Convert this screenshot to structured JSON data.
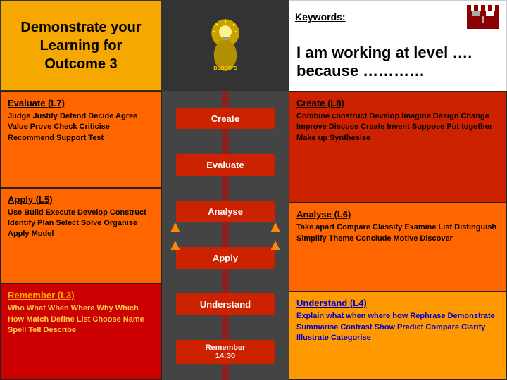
{
  "header": {
    "demonstrate_title": "Demonstrate your Learning for Outcome 3",
    "keywords_label": "Keywords:",
    "i_am_working": "I am working at level …. because …………"
  },
  "left_column": {
    "l7": {
      "title": "Evaluate (L7)",
      "content": "Judge Justify Defend Decide Agree Value Prove Check Criticise Recommend Support Test"
    },
    "l5": {
      "title": "Apply (L5)",
      "content": "Use Build Execute Develop Construct Identify Plan Select Solve Organise Apply Model"
    },
    "l3": {
      "title": "Remember (L3)",
      "content": "Who What When Where Why Which How Match Define List Choose Name Spell Tell Describe"
    }
  },
  "center_column": {
    "steps": [
      {
        "label": "Create"
      },
      {
        "label": "Evaluate"
      },
      {
        "label": "Analyse"
      },
      {
        "label": "Apply"
      },
      {
        "label": "Understand"
      },
      {
        "label": "Remember"
      }
    ],
    "time": "14:30"
  },
  "right_column": {
    "create_l8": {
      "title": "Create (L8)",
      "content": "Combine construct Develop Imagine Design Change Improve Discuss Create Invent Suppose Put together Make up Synthesise"
    },
    "analyse_l6": {
      "title": "Analyse (L6)",
      "content": "Take apart Compare  Classify Examine List Distinguish Simplify Theme Conclude Motive Discover"
    },
    "understand_l4": {
      "title": "Understand (L4)",
      "content": "Explain what when where how Rephrase Demonstrate Summarise Contrast Show Predict Compare Clarify Illustrate Categorise"
    }
  }
}
